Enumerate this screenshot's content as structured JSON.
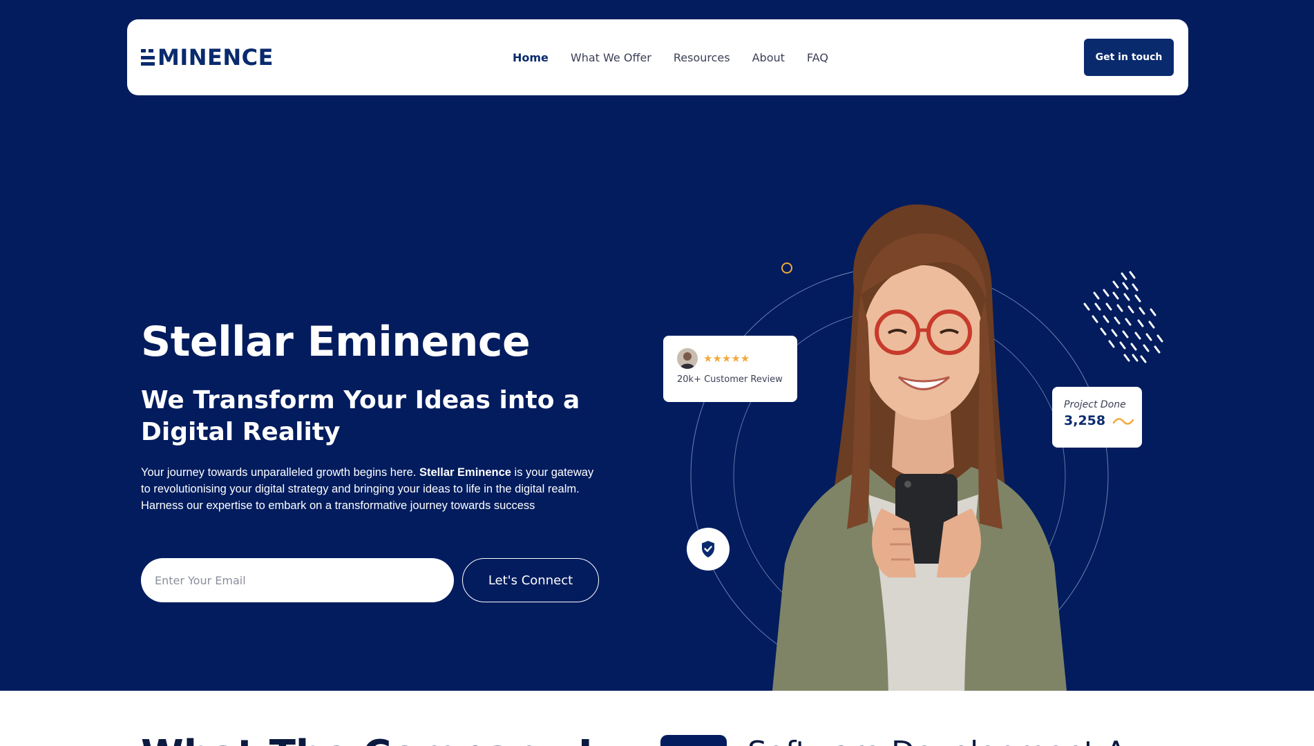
{
  "brand": {
    "logo_text": "MINENCE",
    "accent": "#0a2a6e",
    "hero_bg": "#021c5e",
    "highlight": "#f2a93b"
  },
  "nav": {
    "items": [
      {
        "label": "Home",
        "active": true
      },
      {
        "label": "What We Offer"
      },
      {
        "label": "Resources"
      },
      {
        "label": "About"
      },
      {
        "label": "FAQ"
      }
    ],
    "cta_label": "Get in touch"
  },
  "hero": {
    "title": "Stellar Eminence",
    "subtitle": "We Transform Your Ideas into a Digital Reality",
    "desc_before": "Your journey towards unparalleled growth begins here. ",
    "desc_bold": "Stellar Eminence",
    "desc_after": " is your gateway to revolutionising your digital strategy and bringing your ideas to life in the digital realm. Harness our expertise to embark on a transformative journey towards success",
    "email_placeholder": "Enter Your Email",
    "connect_label": "Let's Connect"
  },
  "review_card": {
    "stars": "★★★★★",
    "text": "20k+ Customer Review"
  },
  "project_card": {
    "label": "Project Done",
    "value": "3,258"
  },
  "icons": {
    "shield": "shield-check-icon",
    "avatar": "reviewer-avatar"
  },
  "next_section": {
    "heading_partial": "What The Company I",
    "tab_partial": "Software Development A"
  }
}
